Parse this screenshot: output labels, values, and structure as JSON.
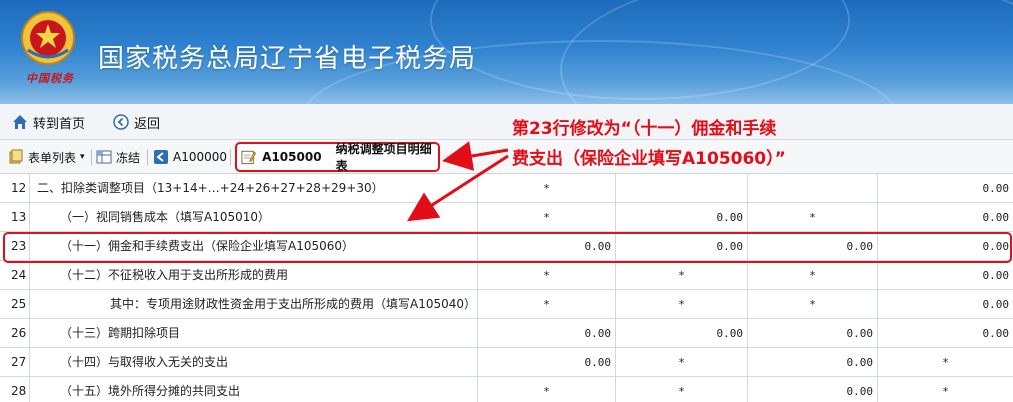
{
  "header": {
    "title": "国家税务总局辽宁省电子税务局",
    "emblem_caption": "中国税务",
    "colors": {
      "banner_top": "#1d6bbd",
      "banner_bottom": "#8fbfe8",
      "highlight": "#d9121b"
    }
  },
  "nav": {
    "home_label": "转到首页",
    "back_label": "返回"
  },
  "toolbar": {
    "form_list_label": "表单列表",
    "freeze_label": "冻结",
    "prev_form_label": "A100000",
    "active_form_code": "A105000",
    "active_form_name": "纳税调整项目明细表"
  },
  "annotation": {
    "line1": "第23行修改为“（十一）佣金和手续",
    "line2": "费支出（保险企业填写A105060）”"
  },
  "table": {
    "rows": [
      {
        "no": "12",
        "name": "二、扣除类调整项目（13+14+…+24+26+27+28+29+30）",
        "indent": 0,
        "v1": "*",
        "v2": "",
        "v3": "",
        "v4": "0.00"
      },
      {
        "no": "13",
        "name": "（一）视同销售成本（填写A105010）",
        "indent": 1,
        "v1": "*",
        "v2": "0.00",
        "v3": "*",
        "v4": "0.00"
      },
      {
        "no": "23",
        "name": "（十一）佣金和手续费支出（保险企业填写A105060）",
        "indent": 1,
        "v1": "0.00",
        "v2": "0.00",
        "v3": "0.00",
        "v4": "0.00"
      },
      {
        "no": "24",
        "name": "（十二）不征税收入用于支出所形成的费用",
        "indent": 1,
        "v1": "*",
        "v2": "*",
        "v3": "*",
        "v4": "0.00"
      },
      {
        "no": "25",
        "name": "其中：专项用途财政性资金用于支出所形成的费用（填写A105040）",
        "indent": 2,
        "v1": "*",
        "v2": "*",
        "v3": "*",
        "v4": "0.00"
      },
      {
        "no": "26",
        "name": "（十三）跨期扣除项目",
        "indent": 1,
        "v1": "0.00",
        "v2": "0.00",
        "v3": "0.00",
        "v4": "0.00"
      },
      {
        "no": "27",
        "name": "（十四）与取得收入无关的支出",
        "indent": 1,
        "v1": "0.00",
        "v2": "*",
        "v3": "0.00",
        "v4": "*"
      },
      {
        "no": "28",
        "name": "（十五）境外所得分摊的共同支出",
        "indent": 1,
        "v1": "*",
        "v2": "*",
        "v3": "0.00",
        "v4": "*"
      }
    ]
  }
}
